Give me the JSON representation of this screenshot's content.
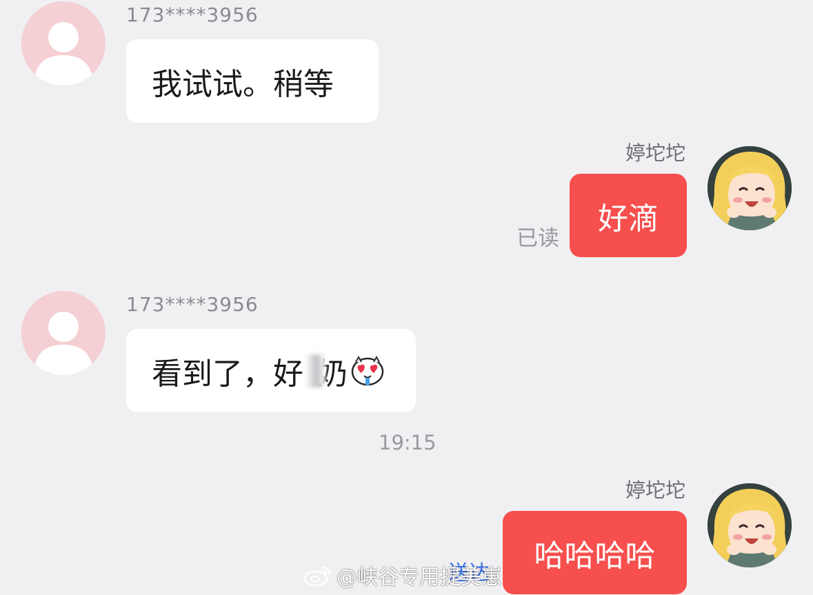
{
  "messages": [
    {
      "sender": "173****3956",
      "text": "我试试。稍等"
    },
    {
      "sender": "婷坨坨",
      "text": "好滴",
      "status": "已读"
    },
    {
      "sender": "173****3956",
      "text_before": "看到了，好",
      "text_after": "奶",
      "emoji": "heart-eyes-crying-emoji-icon"
    },
    {
      "sender": "婷坨坨",
      "text": "哈哈哈哈",
      "status": "送达"
    }
  ],
  "timestamp": "19:15",
  "watermark": {
    "text": "@峡谷专用提美崽",
    "icon": "weibo-logo-icon"
  },
  "colors": {
    "background": "#f0f0f3",
    "incoming_bubble": "#ffffff",
    "outgoing_bubble": "#f64f4d",
    "default_avatar": "#f4cfd3",
    "sent_status": "#3b6fe0"
  }
}
